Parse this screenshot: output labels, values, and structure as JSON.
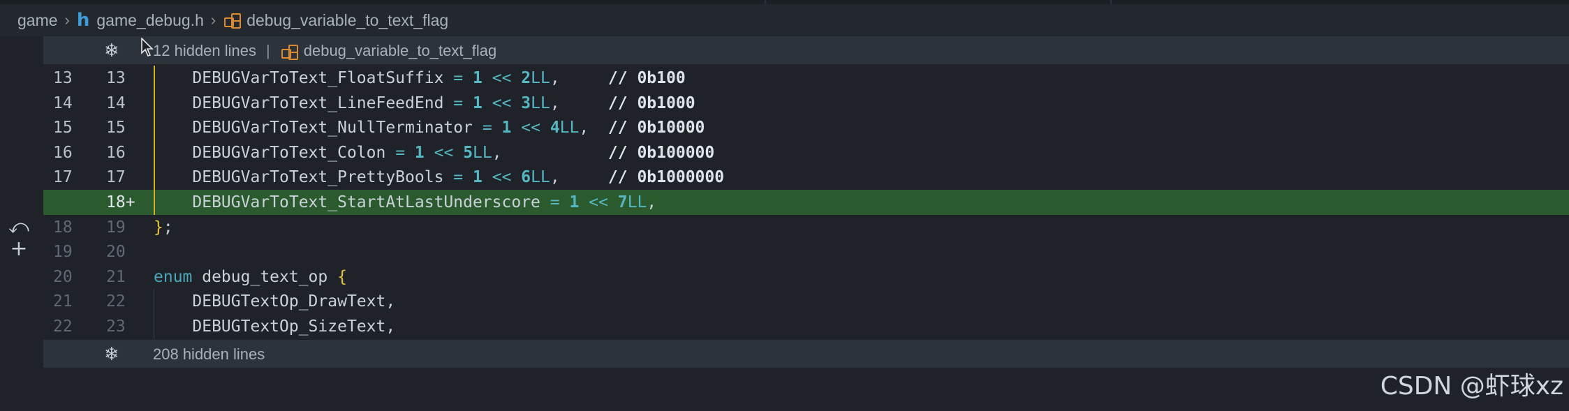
{
  "breadcrumb": {
    "folder": "game",
    "file": "game_debug.h",
    "symbol": "debug_variable_to_text_flag"
  },
  "fold_top": {
    "hidden_text": "12 hidden lines",
    "separator": "|",
    "symbol": "debug_variable_to_text_flag"
  },
  "fold_bottom": {
    "hidden_text": "208 hidden lines"
  },
  "lines": [
    {
      "old": "13",
      "new": "13",
      "code": [
        {
          "t": "    DEBUGVarToText_FloatSuffix "
        },
        {
          "t": "=",
          "c": "op"
        },
        {
          "t": " "
        },
        {
          "t": "1",
          "c": "num"
        },
        {
          "t": " "
        },
        {
          "t": "<<",
          "c": "op"
        },
        {
          "t": " "
        },
        {
          "t": "2",
          "c": "num"
        },
        {
          "t": "LL",
          "c": "op"
        },
        {
          "t": ",     "
        },
        {
          "t": "// 0b100",
          "c": "cm"
        }
      ]
    },
    {
      "old": "14",
      "new": "14",
      "code": [
        {
          "t": "    DEBUGVarToText_LineFeedEnd "
        },
        {
          "t": "=",
          "c": "op"
        },
        {
          "t": " "
        },
        {
          "t": "1",
          "c": "num"
        },
        {
          "t": " "
        },
        {
          "t": "<<",
          "c": "op"
        },
        {
          "t": " "
        },
        {
          "t": "3",
          "c": "num"
        },
        {
          "t": "LL",
          "c": "op"
        },
        {
          "t": ",     "
        },
        {
          "t": "// 0b1000",
          "c": "cm"
        }
      ]
    },
    {
      "old": "15",
      "new": "15",
      "code": [
        {
          "t": "    DEBUGVarToText_NullTerminator "
        },
        {
          "t": "=",
          "c": "op"
        },
        {
          "t": " "
        },
        {
          "t": "1",
          "c": "num"
        },
        {
          "t": " "
        },
        {
          "t": "<<",
          "c": "op"
        },
        {
          "t": " "
        },
        {
          "t": "4",
          "c": "num"
        },
        {
          "t": "LL",
          "c": "op"
        },
        {
          "t": ",  "
        },
        {
          "t": "// 0b10000",
          "c": "cm"
        }
      ]
    },
    {
      "old": "16",
      "new": "16",
      "code": [
        {
          "t": "    DEBUGVarToText_Colon "
        },
        {
          "t": "=",
          "c": "op"
        },
        {
          "t": " "
        },
        {
          "t": "1",
          "c": "num"
        },
        {
          "t": " "
        },
        {
          "t": "<<",
          "c": "op"
        },
        {
          "t": " "
        },
        {
          "t": "5",
          "c": "num"
        },
        {
          "t": "LL",
          "c": "op"
        },
        {
          "t": ",           "
        },
        {
          "t": "// 0b100000",
          "c": "cm"
        }
      ]
    },
    {
      "old": "17",
      "new": "17",
      "code": [
        {
          "t": "    DEBUGVarToText_PrettyBools "
        },
        {
          "t": "=",
          "c": "op"
        },
        {
          "t": " "
        },
        {
          "t": "1",
          "c": "num"
        },
        {
          "t": " "
        },
        {
          "t": "<<",
          "c": "op"
        },
        {
          "t": " "
        },
        {
          "t": "6",
          "c": "num"
        },
        {
          "t": "LL",
          "c": "op"
        },
        {
          "t": ",     "
        },
        {
          "t": "// 0b1000000",
          "c": "cm"
        }
      ]
    },
    {
      "old": "",
      "new": "18+",
      "added": true,
      "code": [
        {
          "t": "    DEBUGVarToText_StartAtLastUnderscore "
        },
        {
          "t": "=",
          "c": "op"
        },
        {
          "t": " "
        },
        {
          "t": "1",
          "c": "num"
        },
        {
          "t": " "
        },
        {
          "t": "<<",
          "c": "op"
        },
        {
          "t": " "
        },
        {
          "t": "7",
          "c": "num"
        },
        {
          "t": "LL",
          "c": "op"
        },
        {
          "t": ","
        }
      ]
    },
    {
      "old": "18",
      "new": "19",
      "code": [
        {
          "t": "}",
          "c": "brace"
        },
        {
          "t": ";"
        }
      ]
    },
    {
      "old": "19",
      "new": "20",
      "code": []
    },
    {
      "old": "20",
      "new": "21",
      "code": [
        {
          "t": "enum",
          "c": "kw"
        },
        {
          "t": " debug_text_op "
        },
        {
          "t": "{",
          "c": "brace"
        }
      ]
    },
    {
      "old": "21",
      "new": "22",
      "code": [
        {
          "t": "    DEBUGTextOp_DrawText,"
        }
      ]
    },
    {
      "old": "22",
      "new": "23",
      "code": [
        {
          "t": "    DEBUGTextOp_SizeText,"
        }
      ]
    }
  ],
  "watermark": "CSDN @虾球xz",
  "colors": {
    "added_line": "#2a5a2e",
    "guide_yellow": "#d4b02a",
    "operator": "#56b6c2",
    "brace": "#e8c33a"
  }
}
